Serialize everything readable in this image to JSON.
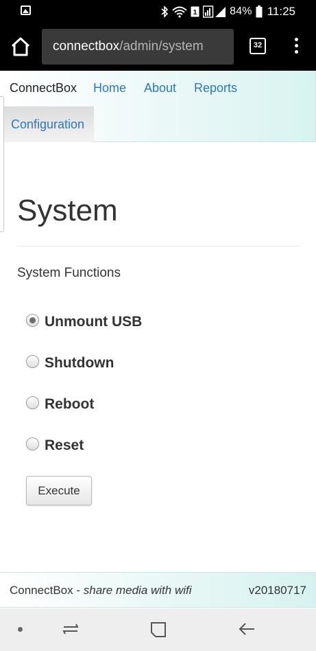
{
  "status_bar": {
    "battery": "84%",
    "time": "11:25",
    "icons": [
      "gallery-icon",
      "bluetooth-icon",
      "wifi-icon",
      "sim-icon",
      "signal-icon",
      "battery-icon"
    ]
  },
  "browser": {
    "url_host": "connectbox",
    "url_path": "/admin/system",
    "tab_count": "32",
    "icons": [
      "home-icon",
      "tabs-icon",
      "more-vert-icon"
    ]
  },
  "nav": {
    "brand": "ConnectBox",
    "links": [
      "Home",
      "About",
      "Reports",
      "Configuration"
    ],
    "active": "Configuration"
  },
  "page": {
    "title": "System",
    "section": "System Functions",
    "options": [
      {
        "label": "Unmount USB",
        "checked": true
      },
      {
        "label": "Shutdown",
        "checked": false
      },
      {
        "label": "Reboot",
        "checked": false
      },
      {
        "label": "Reset",
        "checked": false
      }
    ],
    "execute_label": "Execute"
  },
  "footer": {
    "brand": "ConnectBox",
    "separator": " - ",
    "tagline": "share media with wifi",
    "version": "v20180717"
  },
  "android_nav": {
    "icons": [
      "dot-icon",
      "recents-icon",
      "home-square-icon",
      "back-arrow-icon"
    ]
  }
}
